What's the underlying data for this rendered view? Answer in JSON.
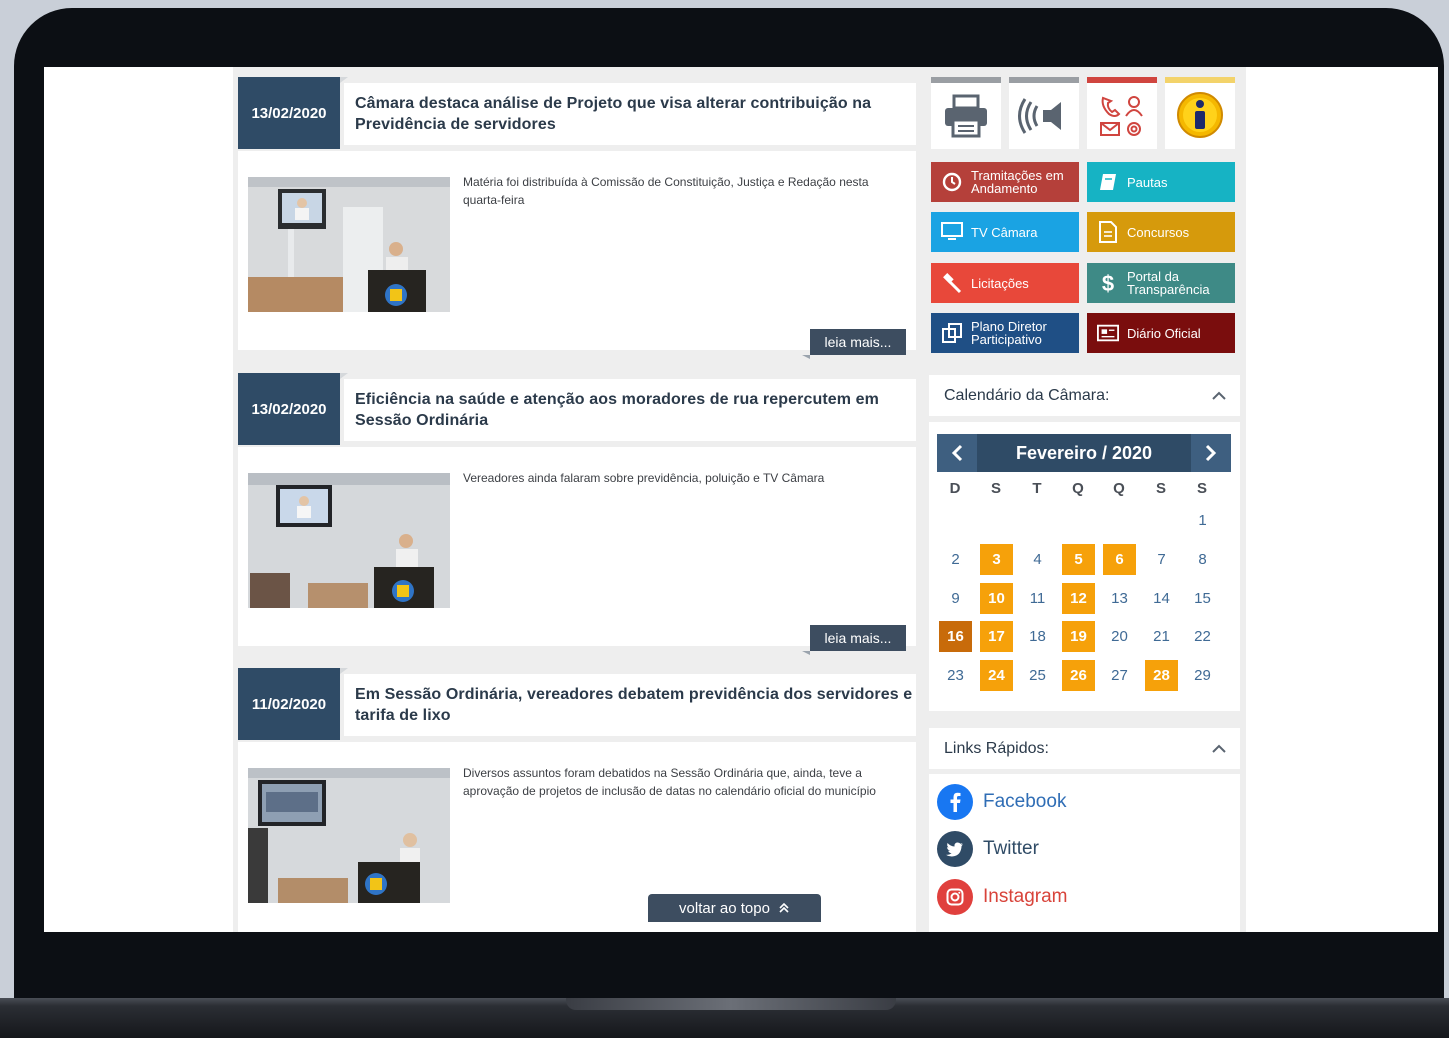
{
  "news": [
    {
      "date": "13/02/2020",
      "title": "Câmara destaca análise de Projeto que visa alterar contribuição na Previdência de servidores",
      "summary": "Matéria foi distribuída à Comissão de Constituição, Justiça e Redação nesta quarta-feira",
      "read_more": "leia mais..."
    },
    {
      "date": "13/02/2020",
      "title": "Eficiência na saúde e atenção aos moradores de rua repercutem em Sessão Ordinária",
      "summary": "Vereadores ainda falaram sobre previdência, poluição e TV Câmara",
      "read_more": "leia mais..."
    },
    {
      "date": "11/02/2020",
      "title": "Em Sessão Ordinária, vereadores debatem previdência dos servidores e tarifa de lixo",
      "summary": "Diversos assuntos foram debatidos na Sessão Ordinária que, ainda, teve a aprovação de projetos de inclusão de datas no calendário oficial do município",
      "read_more": ""
    }
  ],
  "back_to_top": "voltar ao topo",
  "accessibility_tools": [
    "printer-icon",
    "speaker-icon",
    "contact-icon",
    "info-icon"
  ],
  "quick_buttons": [
    {
      "label": "Tramitações em Andamento",
      "color": "#b5403a",
      "icon": "clock-icon"
    },
    {
      "label": "Pautas",
      "color": "#16b3c4",
      "icon": "notebook-icon"
    },
    {
      "label": "TV Câmara",
      "color": "#1aa3e3",
      "icon": "monitor-icon"
    },
    {
      "label": "Concursos",
      "color": "#d69a0c",
      "icon": "document-icon"
    },
    {
      "label": "Licitações",
      "color": "#e8483a",
      "icon": "gavel-icon"
    },
    {
      "label": "Portal da Transparência",
      "color": "#3e8a86",
      "icon": "dollar-icon"
    },
    {
      "label": "Plano Diretor Participativo",
      "color": "#1f4f85",
      "icon": "map-icon"
    },
    {
      "label": "Diário Oficial",
      "color": "#7a0d0d",
      "icon": "newspaper-icon"
    }
  ],
  "calendar": {
    "title": "Calendário da Câmara:",
    "month_label": "Fevereiro / 2020",
    "weekdays": [
      "D",
      "S",
      "T",
      "Q",
      "Q",
      "S",
      "S"
    ],
    "days": [
      {
        "d": "1",
        "s": ""
      },
      {
        "d": "2",
        "s": ""
      },
      {
        "d": "3",
        "s": "hl"
      },
      {
        "d": "4",
        "s": ""
      },
      {
        "d": "5",
        "s": "hl"
      },
      {
        "d": "6",
        "s": "hl"
      },
      {
        "d": "7",
        "s": ""
      },
      {
        "d": "8",
        "s": ""
      },
      {
        "d": "9",
        "s": ""
      },
      {
        "d": "10",
        "s": "hl"
      },
      {
        "d": "11",
        "s": ""
      },
      {
        "d": "12",
        "s": "hl"
      },
      {
        "d": "13",
        "s": ""
      },
      {
        "d": "14",
        "s": ""
      },
      {
        "d": "15",
        "s": ""
      },
      {
        "d": "16",
        "s": "today"
      },
      {
        "d": "17",
        "s": "hl"
      },
      {
        "d": "18",
        "s": ""
      },
      {
        "d": "19",
        "s": "hl"
      },
      {
        "d": "20",
        "s": ""
      },
      {
        "d": "21",
        "s": ""
      },
      {
        "d": "22",
        "s": ""
      },
      {
        "d": "23",
        "s": ""
      },
      {
        "d": "24",
        "s": "hl"
      },
      {
        "d": "25",
        "s": ""
      },
      {
        "d": "26",
        "s": "hl"
      },
      {
        "d": "27",
        "s": ""
      },
      {
        "d": "28",
        "s": "hl"
      },
      {
        "d": "29",
        "s": ""
      }
    ],
    "first_weekday": 6,
    "highlight_color": "#f6a10a",
    "today_color": "#c86b0a"
  },
  "quick_links": {
    "title": "Links Rápidos:",
    "items": [
      {
        "label": "Facebook",
        "color": "#1877f2",
        "text_color": "#2f6db5",
        "icon": "facebook-icon"
      },
      {
        "label": "Twitter",
        "color": "#2f4b66",
        "text_color": "#2f4b66",
        "icon": "twitter-icon"
      },
      {
        "label": "Instagram",
        "color": "#e0403d",
        "text_color": "#d8433a",
        "icon": "instagram-icon"
      }
    ]
  }
}
